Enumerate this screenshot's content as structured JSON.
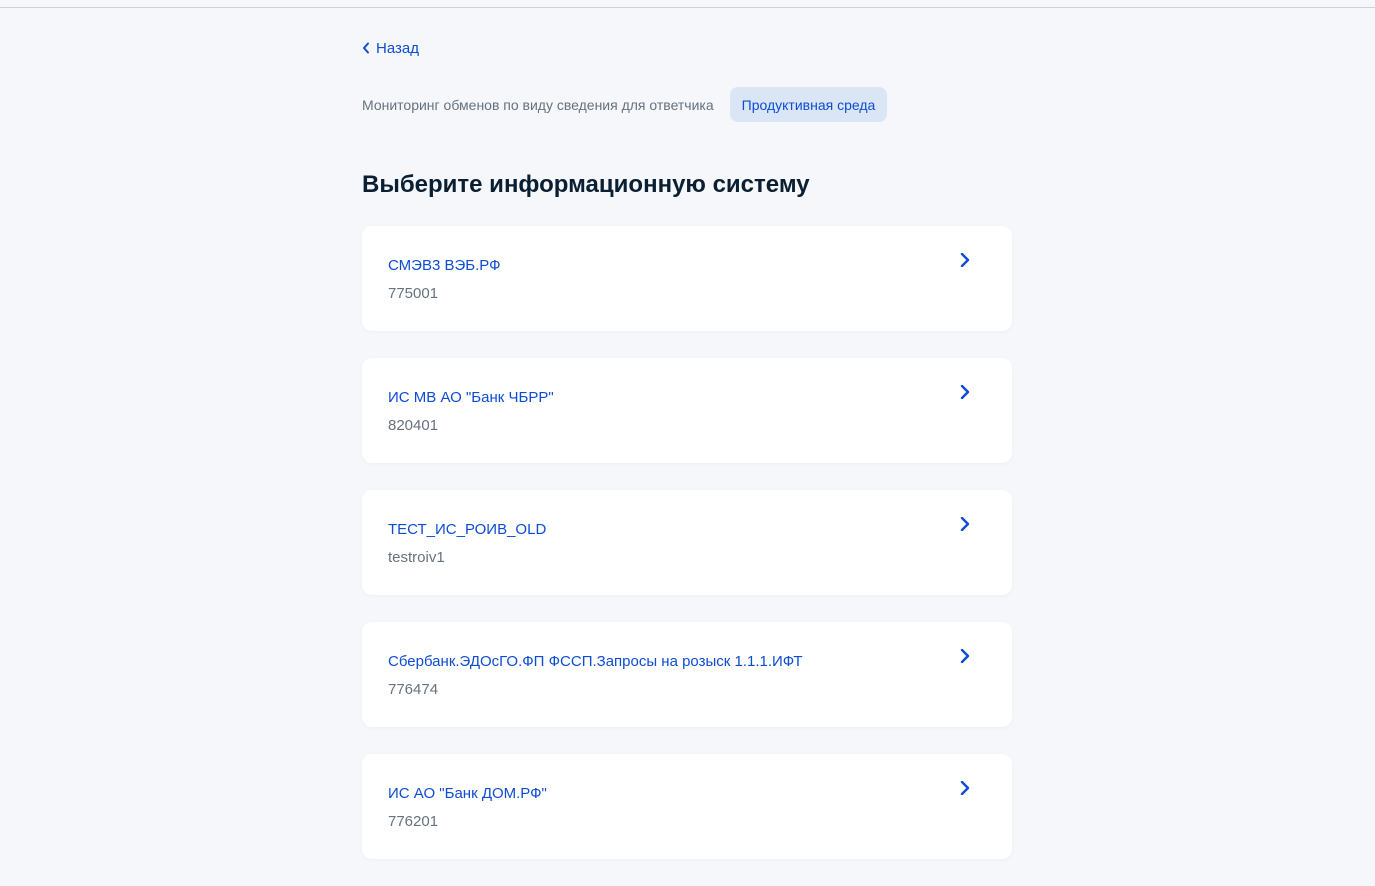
{
  "back": {
    "label": "Назад"
  },
  "service": {
    "name": "Мониторинг обменов по виду сведения для ответчика",
    "environment_badge": "Продуктивная среда"
  },
  "page": {
    "title": "Выберите информационную систему"
  },
  "systems": [
    {
      "name": "СМЭВ3 ВЭБ.РФ",
      "code": "775001"
    },
    {
      "name": "ИС МВ АО \"Банк ЧБРР\"",
      "code": "820401"
    },
    {
      "name": "ТЕСТ_ИС_РОИВ_OLD",
      "code": "testroiv1"
    },
    {
      "name": "Сбербанк.ЭДОсГО.ФП ФССП.Запросы на розыск 1.1.1.ИФТ",
      "code": "776474"
    },
    {
      "name": "ИС АО \"Банк ДОМ.РФ\"",
      "code": "776201"
    }
  ],
  "icons": {
    "back": "chevron-left-icon",
    "card_arrow": "chevron-right-icon"
  },
  "colors": {
    "accent": "#0d4cd3",
    "background": "#f5f7fa",
    "badge_background": "#dae6f5",
    "muted_text": "#66727f",
    "title_text": "#0b1f33",
    "card_background": "#ffffff"
  }
}
